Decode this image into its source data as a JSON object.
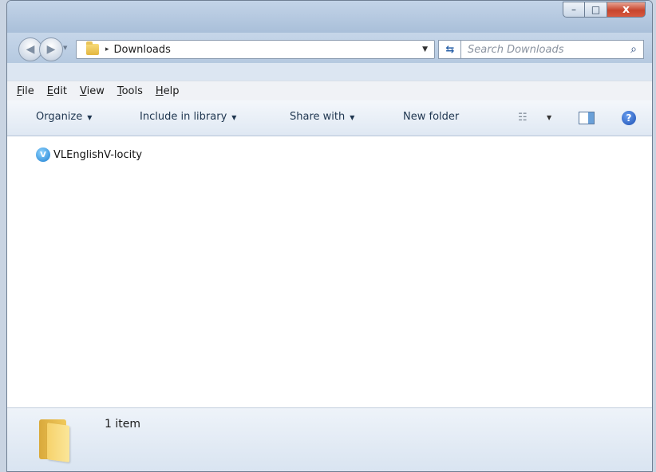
{
  "window": {
    "caption_buttons": {
      "minimize": "–",
      "maximize": "□",
      "close": "x"
    }
  },
  "nav": {
    "back_icon": "back-arrow",
    "forward_icon": "forward-arrow",
    "address": {
      "separator": "▸",
      "crumb": "Downloads",
      "dropdown": "▼"
    },
    "refresh_icon": "refresh",
    "search": {
      "placeholder": "Search Downloads"
    }
  },
  "menubar": {
    "items": [
      "File",
      "Edit",
      "View",
      "Tools",
      "Help"
    ]
  },
  "toolbar": {
    "organize": "Organize",
    "include_in_library": "Include in library",
    "share_with": "Share with",
    "new_folder": "New folder"
  },
  "content": {
    "files": [
      {
        "name": "VLEnglishV-locity",
        "icon": "app-icon"
      }
    ]
  },
  "statusbar": {
    "item_count": "1 item"
  }
}
